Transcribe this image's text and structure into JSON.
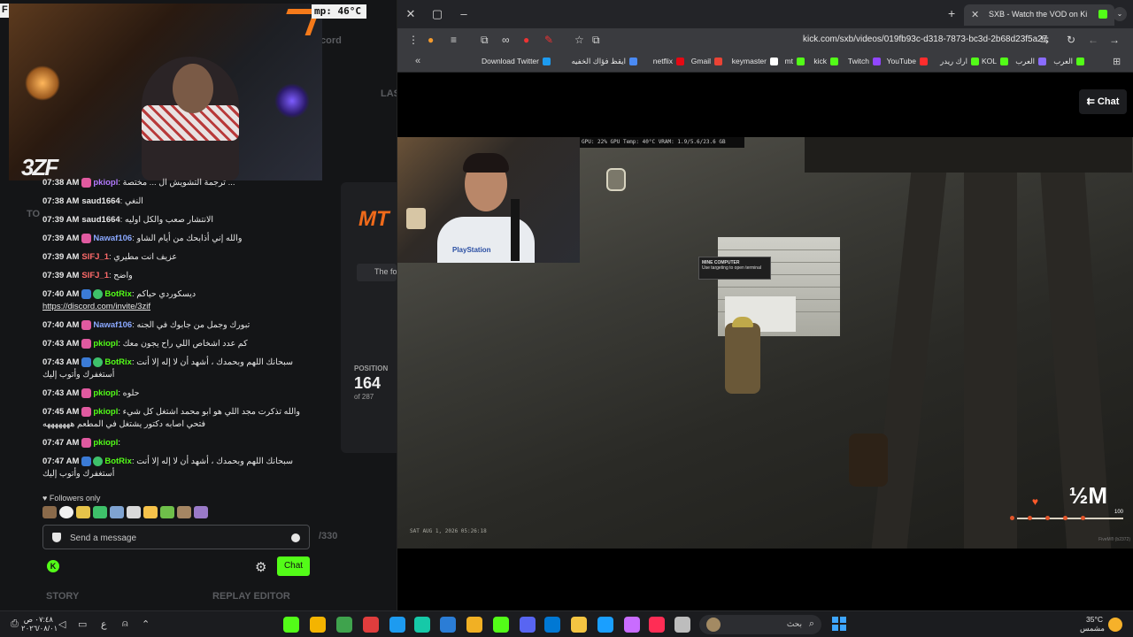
{
  "left_app": {
    "top_label": "F",
    "temp_label": "mp: 46°C",
    "ghost_texts": {
      "cord": "cord",
      "las": "LAS",
      "to": "TO",
      "story": "STORY",
      "replay": "REPLAY EDITOR",
      "slash330": "/330"
    },
    "webcam_logo": "3ZF",
    "chat_messages": [
      {
        "time": "07:38 AM",
        "user": "pkiopl",
        "user_color": "#b47bff",
        "badge": "pink",
        "text": "ترجمة التشويش ال ... مختصة ..."
      },
      {
        "time": "07:38 AM",
        "user": "saud1664",
        "user_color": "#e8e8e8",
        "badge": "",
        "text": "النغي"
      },
      {
        "time": "07:39 AM",
        "user": "saud1664",
        "user_color": "#e8e8e8",
        "badge": "",
        "text": "الانتشار صعب والكل اوليه"
      },
      {
        "time": "07:39 AM",
        "user": "Nawaf106",
        "user_color": "#8aa8ff",
        "badge": "pink",
        "text": "والله إني أذابحك من أيام الشاو"
      },
      {
        "time": "07:39 AM",
        "user": "SIFJ_1",
        "user_color": "#ff6a6a",
        "badge": "",
        "text": "عزيف انت مطيري"
      },
      {
        "time": "07:39 AM",
        "user": "SIFJ_1",
        "user_color": "#ff6a6a",
        "badge": "",
        "text": "واضح"
      },
      {
        "time": "07:40 AM",
        "user": "BotRix",
        "user_color": "#53fc18",
        "badge": "blue",
        "text": "ديسكوردي حياكم",
        "link": "https://discord.com/invite/3zif"
      },
      {
        "time": "07:40 AM",
        "user": "Nawaf106",
        "user_color": "#8aa8ff",
        "badge": "pink",
        "text": "تبورك وجمل من جابوك في الجنه"
      },
      {
        "time": "07:43 AM",
        "user": "pkiopl",
        "user_color": "#53fc18",
        "badge": "pink",
        "text": "كم عدد اشخاص اللي راح يجون معك"
      },
      {
        "time": "07:43 AM",
        "user": "BotRix",
        "user_color": "#53fc18",
        "badge": "blue",
        "text": "سبحانك اللهم وبحمدك ، أشهد أن لا إله إلا أنت أستغفرك وأتوب إليك"
      },
      {
        "time": "07:43 AM",
        "user": "pkiopl",
        "user_color": "#53fc18",
        "badge": "pink",
        "text": "حلوه"
      },
      {
        "time": "07:45 AM",
        "user": "pkiopl",
        "user_color": "#53fc18",
        "badge": "pink",
        "text": "والله تذكرت مجد اللي هو ابو محمد اشتغل كل شيء فتحي اصابه دكتور يشتغل في المطعم هههههههه"
      },
      {
        "time": "07:47 AM",
        "user": "pkiopl",
        "user_color": "#53fc18",
        "badge": "pink",
        "text": ""
      },
      {
        "time": "07:47 AM",
        "user": "BotRix",
        "user_color": "#53fc18",
        "badge": "blue",
        "text": "سبحانك اللهم وبحمدك ، أشهد أن لا إله إلا أنت أستغفرك وأتوب إليك"
      }
    ],
    "followers_only": "♥ Followers only",
    "send_placeholder": "Send a message",
    "chat_button": "Chat",
    "kick_icon": "K",
    "card": {
      "mt": "MT",
      "notice": "The fo",
      "position_label": "POSITION",
      "position": "164",
      "of_total": "of 287"
    }
  },
  "browser": {
    "tab_title": "SXB - Watch the VOD on Ki",
    "url": "kick.com/sxb/videos/019fb93c-d318-7873-bc3d-2b68d23f5a27",
    "bookmarks": [
      {
        "label": "العرب",
        "color": "#53fc18"
      },
      {
        "label": "العرب",
        "color": "#8a6cff"
      },
      {
        "label": "KOL",
        "color": "#53fc18"
      },
      {
        "label": "ارك ريدر",
        "color": "#53fc18"
      },
      {
        "label": "YouTube",
        "color": "#ff2d2d"
      },
      {
        "label": "Twitch",
        "color": "#9146ff"
      },
      {
        "label": "kick",
        "color": "#53fc18"
      },
      {
        "label": "mt",
        "color": "#53fc18"
      },
      {
        "label": "keymaster",
        "color": "#ffffff"
      },
      {
        "label": "Gmail",
        "color": "#ea4335"
      },
      {
        "label": "netflix",
        "color": "#e50914"
      },
      {
        "label": "ايقظ فؤاك الخفيه",
        "color": "#4a8af4"
      },
      {
        "label": "Download Twitter",
        "color": "#1d9bf0"
      }
    ],
    "chat_toggle": "⇇ Chat",
    "stats": "GPU: 22%   GPU Temp: 40°C   VRAM: 1.9/5.6/23.6 GB",
    "game": {
      "popup_title": "MINE COMPUTER",
      "popup_sub": "Use targeting to open terminal",
      "timestamp": "SAT AUG 1, 2026 05:26:18",
      "half_m": "½M",
      "hud_value": "100",
      "watermark": "FiveM® (b2372)"
    },
    "pip_shirt": "PlayStation"
  },
  "taskbar": {
    "clock_time": "٠٧:٤٨ ص",
    "clock_date": "٢٠٢٦/٠٨/٠١",
    "search": "بحث",
    "weather_temp": "35°C",
    "weather_text": "مشمس",
    "lang": "ع",
    "apps": [
      "#53fc18",
      "#f4b400",
      "#3fa34d",
      "#e03d3d",
      "#1d9bf0",
      "#16c9a8",
      "#2b7dd6",
      "#f1b024",
      "#53fc18",
      "#5865f2",
      "#0078d4",
      "#f4c542",
      "#1a9fff",
      "#c96cff",
      "#ff2d55",
      "#bdbdbd"
    ]
  }
}
